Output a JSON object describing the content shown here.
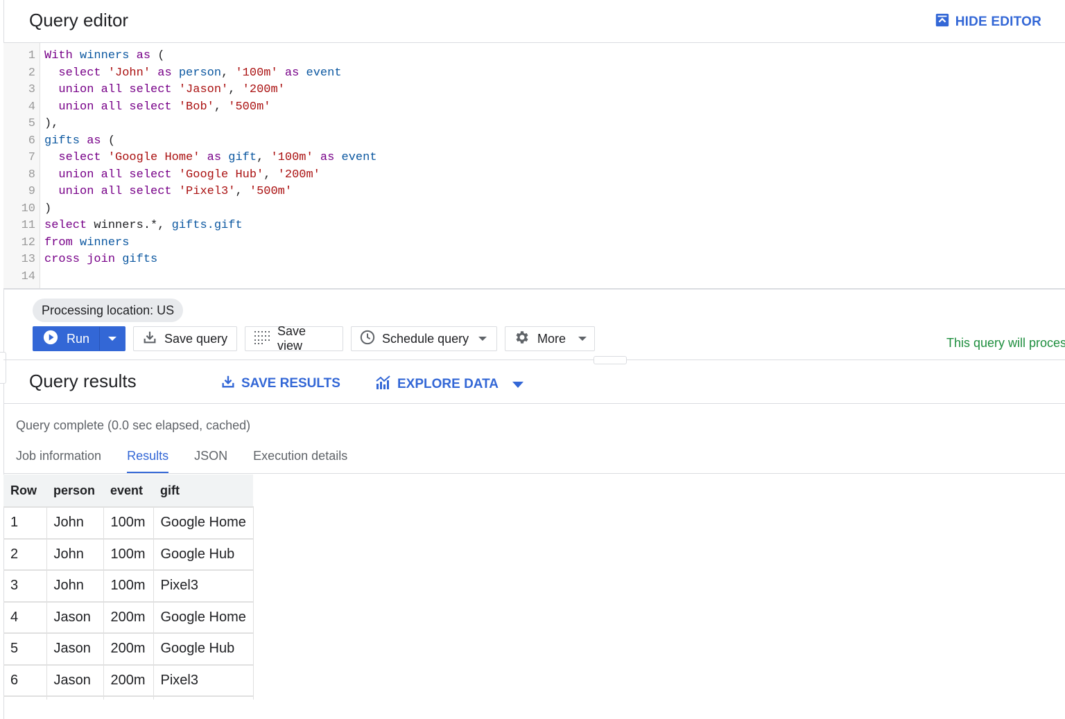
{
  "editor": {
    "title": "Query editor",
    "hide_label": "HIDE EDITOR",
    "lines": [
      {
        "n": "1",
        "tokens": [
          [
            "kw",
            "With "
          ],
          [
            "id",
            "winners "
          ],
          [
            "kw",
            "as "
          ],
          [
            "pl",
            "("
          ]
        ]
      },
      {
        "n": "2",
        "tokens": [
          [
            "pl",
            "  "
          ],
          [
            "kw",
            "select "
          ],
          [
            "str",
            "'John' "
          ],
          [
            "kw",
            "as "
          ],
          [
            "id",
            "person"
          ],
          [
            "pl",
            ", "
          ],
          [
            "str",
            "'100m' "
          ],
          [
            "kw",
            "as "
          ],
          [
            "id",
            "event"
          ]
        ]
      },
      {
        "n": "3",
        "tokens": [
          [
            "pl",
            "  "
          ],
          [
            "kw",
            "union all select "
          ],
          [
            "str",
            "'Jason'"
          ],
          [
            "pl",
            ", "
          ],
          [
            "str",
            "'200m'"
          ]
        ]
      },
      {
        "n": "4",
        "tokens": [
          [
            "pl",
            "  "
          ],
          [
            "kw",
            "union all select "
          ],
          [
            "str",
            "'Bob'"
          ],
          [
            "pl",
            ", "
          ],
          [
            "str",
            "'500m'"
          ]
        ]
      },
      {
        "n": "5",
        "tokens": [
          [
            "pl",
            "),"
          ]
        ]
      },
      {
        "n": "6",
        "tokens": [
          [
            "id",
            "gifts "
          ],
          [
            "kw",
            "as "
          ],
          [
            "pl",
            "("
          ]
        ]
      },
      {
        "n": "7",
        "tokens": [
          [
            "pl",
            "  "
          ],
          [
            "kw",
            "select "
          ],
          [
            "str",
            "'Google Home' "
          ],
          [
            "kw",
            "as "
          ],
          [
            "id",
            "gift"
          ],
          [
            "pl",
            ", "
          ],
          [
            "str",
            "'100m' "
          ],
          [
            "kw",
            "as "
          ],
          [
            "id",
            "event"
          ]
        ]
      },
      {
        "n": "8",
        "tokens": [
          [
            "pl",
            "  "
          ],
          [
            "kw",
            "union all select "
          ],
          [
            "str",
            "'Google Hub'"
          ],
          [
            "pl",
            ", "
          ],
          [
            "str",
            "'200m'"
          ]
        ]
      },
      {
        "n": "9",
        "tokens": [
          [
            "pl",
            "  "
          ],
          [
            "kw",
            "union all select "
          ],
          [
            "str",
            "'Pixel3'"
          ],
          [
            "pl",
            ", "
          ],
          [
            "str",
            "'500m'"
          ]
        ]
      },
      {
        "n": "10",
        "tokens": [
          [
            "pl",
            ")"
          ]
        ]
      },
      {
        "n": "11",
        "tokens": [
          [
            "kw",
            "select "
          ],
          [
            "pl",
            "winners.*, "
          ],
          [
            "id",
            "gifts.gift"
          ]
        ]
      },
      {
        "n": "12",
        "tokens": [
          [
            "kw",
            "from "
          ],
          [
            "id",
            "winners"
          ]
        ]
      },
      {
        "n": "13",
        "tokens": [
          [
            "kw",
            "cross join "
          ],
          [
            "id",
            "gifts"
          ]
        ]
      },
      {
        "n": "14",
        "tokens": []
      }
    ]
  },
  "processing_location": "Processing location: US",
  "toolbar": {
    "run": "Run",
    "save_query": "Save query",
    "save_view": "Save view",
    "schedule_query": "Schedule query",
    "more": "More"
  },
  "process_note": "This query will proces",
  "results": {
    "title": "Query results",
    "save_results": "SAVE RESULTS",
    "explore_data": "EXPLORE DATA",
    "status": "Query complete (0.0 sec elapsed, cached)",
    "tabs": [
      "Job information",
      "Results",
      "JSON",
      "Execution details"
    ],
    "active_tab": "Results",
    "columns": [
      "Row",
      "person",
      "event",
      "gift"
    ],
    "rows": [
      [
        "1",
        "John",
        "100m",
        "Google Home"
      ],
      [
        "2",
        "John",
        "100m",
        "Google Hub"
      ],
      [
        "3",
        "John",
        "100m",
        "Pixel3"
      ],
      [
        "4",
        "Jason",
        "200m",
        "Google Home"
      ],
      [
        "5",
        "Jason",
        "200m",
        "Google Hub"
      ],
      [
        "6",
        "Jason",
        "200m",
        "Pixel3"
      ]
    ]
  },
  "colors": {
    "accent": "#3367d6",
    "keyword": "#770088",
    "identifier": "#0b57a0",
    "string": "#aa1111",
    "note": "#1e8e3e"
  }
}
